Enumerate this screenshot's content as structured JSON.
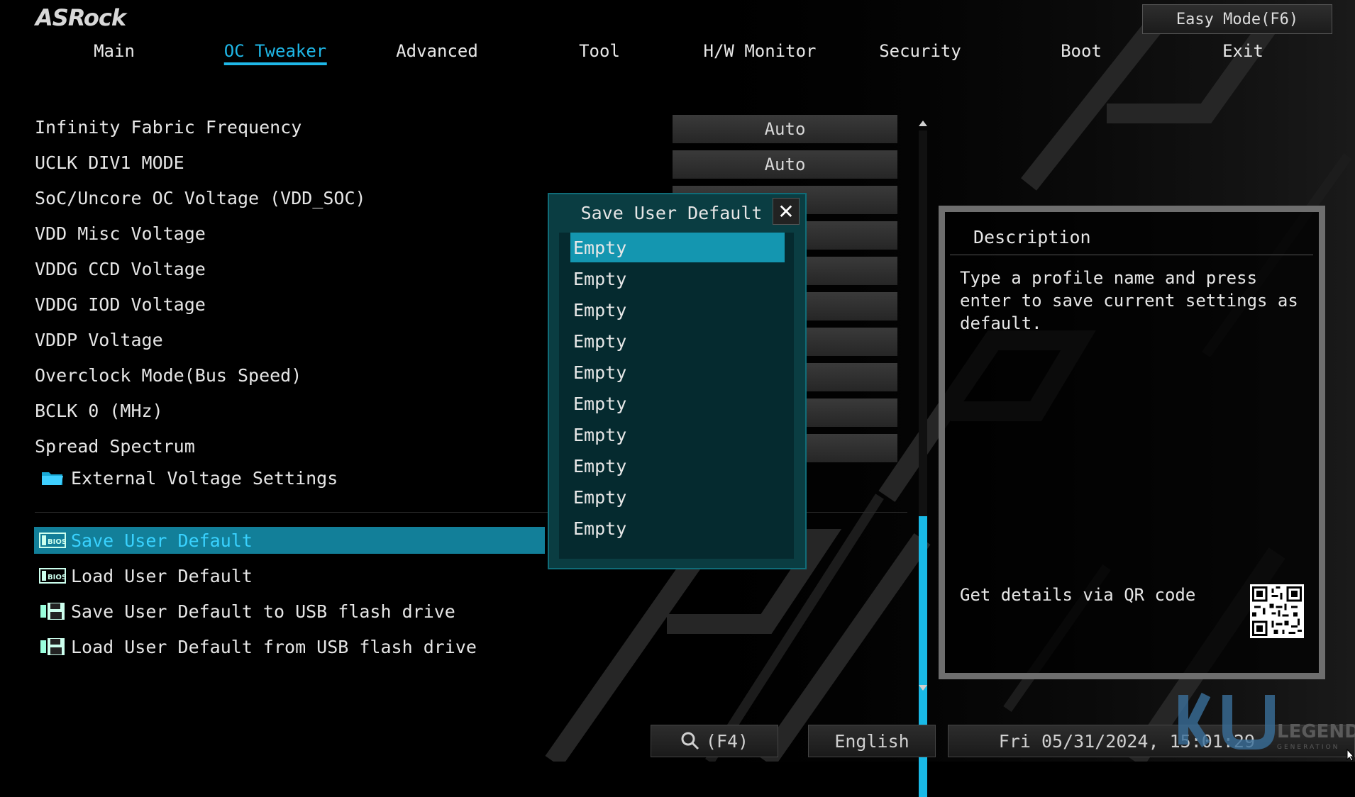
{
  "header": {
    "logo": "ASRock",
    "easy_mode_label": "Easy Mode(F6)"
  },
  "tabs": [
    {
      "label": "Main",
      "active": false
    },
    {
      "label": "OC Tweaker",
      "active": true
    },
    {
      "label": "Advanced",
      "active": false
    },
    {
      "label": "Tool",
      "active": false
    },
    {
      "label": "H/W Monitor",
      "active": false
    },
    {
      "label": "Security",
      "active": false
    },
    {
      "label": "Boot",
      "active": false
    },
    {
      "label": "Exit",
      "active": false
    }
  ],
  "settings": [
    {
      "label": "Infinity Fabric Frequency",
      "value": "Auto"
    },
    {
      "label": "UCLK DIV1 MODE",
      "value": "Auto"
    },
    {
      "label": "SoC/Uncore OC Voltage (VDD_SOC)",
      "value": ""
    },
    {
      "label": "VDD Misc Voltage",
      "value": ""
    },
    {
      "label": "VDDG CCD Voltage",
      "value": ""
    },
    {
      "label": "VDDG IOD Voltage",
      "value": ""
    },
    {
      "label": "VDDP Voltage",
      "value": ""
    },
    {
      "label": "Overclock Mode(Bus Speed)",
      "value": ""
    },
    {
      "label": "BCLK 0 (MHz)",
      "value": ""
    },
    {
      "label": "Spread Spectrum",
      "value": ""
    }
  ],
  "submenu": {
    "label": "External Voltage Settings",
    "icon": "folder-icon"
  },
  "profile_menu": [
    {
      "label": "Save User Default",
      "icon": "bios-icon",
      "selected": true
    },
    {
      "label": "Load User Default",
      "icon": "bios-icon",
      "selected": false
    },
    {
      "label": "Save User Default to USB flash drive",
      "icon": "floppy-icon",
      "selected": false
    },
    {
      "label": "Load User Default from USB flash drive",
      "icon": "floppy-icon",
      "selected": false
    }
  ],
  "dialog": {
    "title": "Save User Default",
    "close_symbol": "✕",
    "slots": [
      "Empty",
      "Empty",
      "Empty",
      "Empty",
      "Empty",
      "Empty",
      "Empty",
      "Empty",
      "Empty",
      "Empty"
    ],
    "selected_index": 0
  },
  "description": {
    "title": "Description",
    "text": "Type a profile name and press enter to save current settings as default.",
    "qr_label": "Get details via QR code"
  },
  "footer": {
    "search_label": "(F4)",
    "language": "English",
    "datetime": "Fri 05/31/2024, 15:01:29"
  },
  "colors": {
    "accent": "#1fb8e8",
    "selection_bg": "#127f99",
    "dialog_bg": "#0a3d42"
  }
}
